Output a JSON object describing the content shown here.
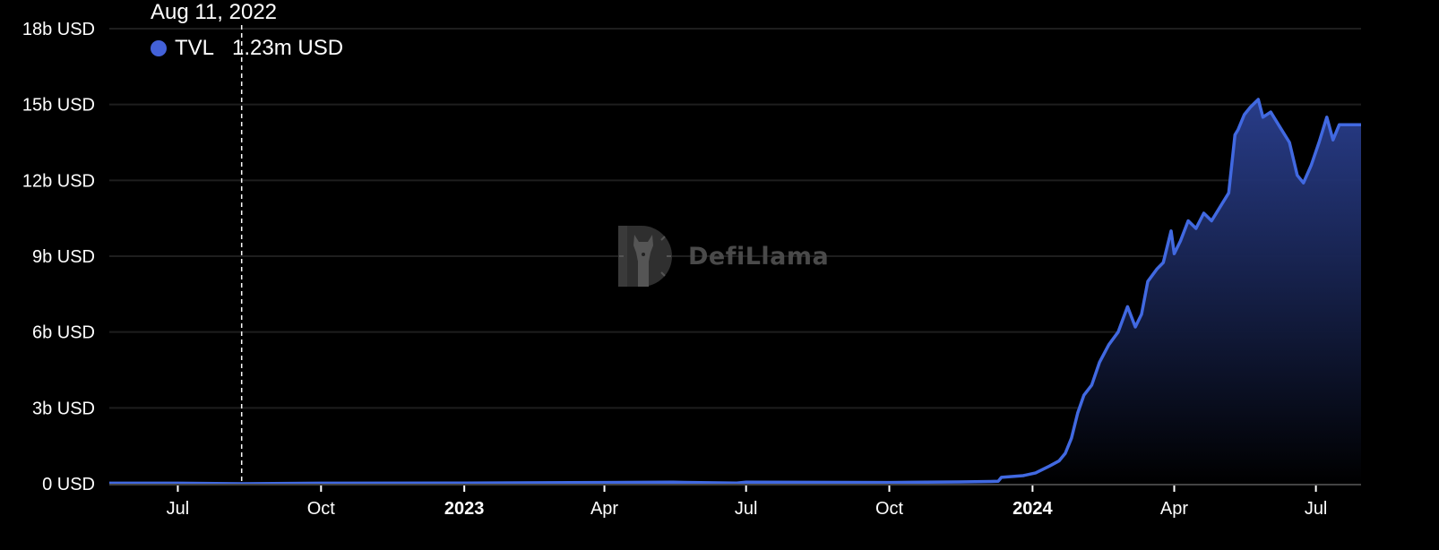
{
  "tooltip": {
    "date": "Aug 11, 2022",
    "series": "TVL",
    "value": "1.23m USD",
    "dot_color": "#4361d8"
  },
  "watermark": {
    "text": "DefiLlama",
    "icon": "defillama-llama-logo-icon"
  },
  "colors": {
    "line": "#4169e1",
    "fill_top": "#2a3f8f",
    "background": "#000000",
    "grid": "#1e1e1e",
    "crosshair": "#ffffff"
  },
  "chart_data": {
    "type": "area",
    "title": "",
    "xlabel": "",
    "ylabel": "",
    "series": [
      {
        "name": "TVL",
        "unit": "billion USD",
        "x": [
          "2022-05-18",
          "2022-07-01",
          "2022-08-11",
          "2022-10-01",
          "2023-01-01",
          "2023-04-01",
          "2023-05-15",
          "2023-06-25",
          "2023-07-01",
          "2023-10-01",
          "2023-11-15",
          "2023-12-05",
          "2023-12-10",
          "2023-12-12",
          "2023-12-26",
          "2024-01-03",
          "2024-01-12",
          "2024-01-18",
          "2024-01-22",
          "2024-01-26",
          "2024-01-30",
          "2024-02-03",
          "2024-02-08",
          "2024-02-13",
          "2024-02-19",
          "2024-02-25",
          "2024-03-02",
          "2024-03-07",
          "2024-03-11",
          "2024-03-15",
          "2024-03-21",
          "2024-03-25",
          "2024-03-30",
          "2024-04-01",
          "2024-04-05",
          "2024-04-10",
          "2024-04-15",
          "2024-04-20",
          "2024-04-25",
          "2024-05-01",
          "2024-05-06",
          "2024-05-10",
          "2024-05-12",
          "2024-05-16",
          "2024-05-20",
          "2024-05-25",
          "2024-05-28",
          "2024-06-02",
          "2024-06-08",
          "2024-06-14",
          "2024-06-19",
          "2024-06-23",
          "2024-06-28",
          "2024-07-03",
          "2024-07-08",
          "2024-07-12",
          "2024-07-16",
          "2024-07-20"
        ],
        "values": [
          0.02,
          0.02,
          0.00123,
          0.02,
          0.03,
          0.05,
          0.06,
          0.03,
          0.06,
          0.05,
          0.07,
          0.09,
          0.1,
          0.25,
          0.32,
          0.43,
          0.7,
          0.9,
          1.2,
          1.8,
          2.8,
          3.5,
          3.9,
          4.8,
          5.5,
          6.0,
          7.0,
          6.2,
          6.7,
          8.0,
          8.5,
          8.75,
          10.0,
          9.1,
          9.6,
          10.4,
          10.1,
          10.7,
          10.4,
          11.0,
          11.5,
          13.8,
          14.0,
          14.6,
          14.9,
          15.2,
          14.5,
          14.7,
          14.1,
          13.5,
          12.2,
          11.9,
          12.6,
          13.5,
          14.5,
          13.6,
          14.2,
          14.2
        ]
      }
    ],
    "y_tick_labels": [
      "0 USD",
      "3b USD",
      "6b USD",
      "9b USD",
      "12b USD",
      "15b USD",
      "18b USD"
    ],
    "y_ticks": [
      0,
      3,
      6,
      9,
      12,
      15,
      18
    ],
    "ylim": [
      0,
      18
    ],
    "x_tick_labels": [
      {
        "label": "Jul",
        "date": "2022-07-01",
        "bold": false
      },
      {
        "label": "Oct",
        "date": "2022-10-01",
        "bold": false
      },
      {
        "label": "2023",
        "date": "2023-01-01",
        "bold": true
      },
      {
        "label": "Apr",
        "date": "2023-04-01",
        "bold": false
      },
      {
        "label": "Jul",
        "date": "2023-07-01",
        "bold": false
      },
      {
        "label": "Oct",
        "date": "2023-10-01",
        "bold": false
      },
      {
        "label": "2024",
        "date": "2024-01-01",
        "bold": true
      },
      {
        "label": "Apr",
        "date": "2024-04-01",
        "bold": false
      },
      {
        "label": "Jul",
        "date": "2024-07-01",
        "bold": false
      }
    ],
    "xlim": [
      "2022-05-18",
      "2024-07-30"
    ],
    "crosshair_date": "2022-08-11",
    "grid": true,
    "legend": "top-left tooltip"
  }
}
